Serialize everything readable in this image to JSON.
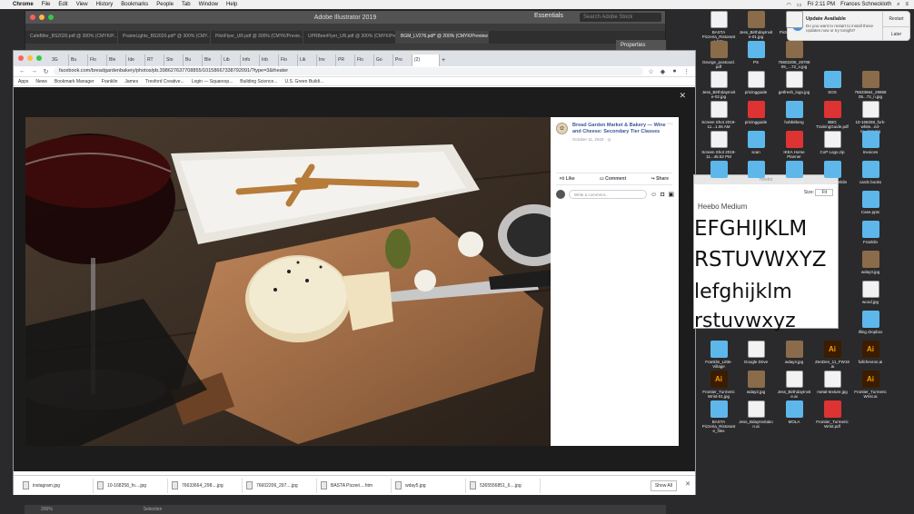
{
  "menubar": {
    "app": "Chrome",
    "items": [
      "File",
      "Edit",
      "View",
      "History",
      "Bookmarks",
      "People",
      "Tab",
      "Window",
      "Help"
    ],
    "clock": "Fri 2:11 PM",
    "user": "Frances Schneckloth"
  },
  "illustrator": {
    "title": "Adobe Illustrator 2019",
    "workspace": "Essentials",
    "search_placeholder": "Search Adobe Stock",
    "tabs": [
      "CafeBifer_BS2020.pdf @ 300% (CMYK/P...",
      "PrairieLights_BS2020.pdf* @ 300% (CMY...",
      "PilotFlyer_UR.pdf @ 300% (CMYK/Previe...",
      "UPRBeerFlyer_UR.pdf @ 300% (CMYK/Prev...",
      "BGM_LV276.pdf* @ 200% (CMYK/Preview)"
    ],
    "active_tab_index": 4,
    "panel": "Properties"
  },
  "chrome": {
    "tabs": [
      "3G",
      "Bu",
      "Flo",
      "Ble",
      "Ide",
      "RT",
      "Sto",
      "Bu",
      "Ble",
      "Lib",
      "Info",
      "Inb",
      "Flo",
      "Lik",
      "Inv",
      "PR",
      "Flo",
      "Go",
      "Pro"
    ],
    "active_tab": "(2)",
    "url": "facebook.com/breadgardenbakery/photos/pb.398627637708855/10158667338792091/?type=3&theater",
    "bookmarks": [
      "Apps",
      "News",
      "Bookmark Manager",
      "Franklin",
      "James",
      "Tresford Creative...",
      "Login — Squaresp...",
      "Building Science...",
      "U.S. Green Buildi..."
    ]
  },
  "post": {
    "page_name": "Bread Garden Market & Bakery",
    "title_rest": " — Wine and Cheese: Secondary Tier Classes",
    "date": "October 11, 2020 · ",
    "like": "Like",
    "comment": "Comment",
    "share": "Share",
    "comment_placeholder": "Write a comment..."
  },
  "downloads": [
    "instagram.jpg",
    "10-168258_fo....jpg",
    "76633664_298....jpg",
    "76602206_297....jpg",
    "BASTA Pizzeri....htm",
    "wday5.jpg",
    "5365556851_6....jpg"
  ],
  "downloads_show_all": "Show All",
  "fontbook": {
    "title": "Heebo",
    "size_label": "Size:",
    "size_value": "Fit",
    "face": "Heebo Medium",
    "lines": [
      "EFGHIJKLM",
      "RSTUVWXYZ",
      "lefghijklm",
      "rstuvwxyz"
    ]
  },
  "notification": {
    "title": "Update Available",
    "body": "Do you want to restart to install these updates now or try tonight?",
    "restart": "Restart",
    "later": "Later"
  },
  "desktop_icons": [
    {
      "label": "BASTA Pizzeria_Ristorante.htm",
      "kind": "file"
    },
    {
      "label": "Jess_BirthdayInvite-01.jpg",
      "kind": "img"
    },
    {
      "label": "Picture ctopping",
      "kind": "file"
    },
    {
      "label": "George_postcard.pdf",
      "kind": "img"
    },
    {
      "label": "PS",
      "kind": "folder"
    },
    {
      "label": "76602206_29708 09_...72_o.jpg",
      "kind": "img"
    },
    {
      "label": "Jess_BirthdayInvite-02.jpg",
      "kind": "file"
    },
    {
      "label": "pricingguide",
      "kind": "file"
    },
    {
      "label": "getfresh_logo.jpg",
      "kind": "file"
    },
    {
      "label": "SOS",
      "kind": "folder"
    },
    {
      "label": "76633664_29858 05...72_n.jpg",
      "kind": "img"
    },
    {
      "label": "Screen Shot 2019-11...1.06 AM",
      "kind": "file"
    },
    {
      "label": "pricingguide",
      "kind": "pdf"
    },
    {
      "label": "hobbitberg",
      "kind": "folder"
    },
    {
      "label": "BBG TrainingGuide.pdf",
      "kind": "pdf"
    },
    {
      "label": "10-168258_fork-white...nd-ro...iron.jpg",
      "kind": "file"
    },
    {
      "label": "Screen Shot 2019-11...45.52 PM",
      "kind": "file"
    },
    {
      "label": "scan",
      "kind": "folder"
    },
    {
      "label": "IKEA Home Planner",
      "kind": "pdf"
    },
    {
      "label": "CoP Logo.zip",
      "kind": "file"
    },
    {
      "label": "Invoices",
      "kind": "folder"
    },
    {
      "label": "Cabin Photos",
      "kind": "folder"
    },
    {
      "label": "James",
      "kind": "folder"
    },
    {
      "label": "• CLIENTS",
      "kind": "folder"
    },
    {
      "label": "FrancesFranklin (1).pdf",
      "kind": "folder"
    },
    {
      "label": "cards books",
      "kind": "folder"
    },
    {
      "label": "Case.pptx",
      "kind": "folder"
    },
    {
      "label": "Franklin",
      "kind": "folder"
    },
    {
      "label": "wday3.jpg",
      "kind": "img"
    },
    {
      "label": "wood.jpg",
      "kind": "file"
    },
    {
      "label": "Illing dropbox",
      "kind": "folder"
    },
    {
      "label": "Franklin_Little-Village",
      "kind": "folder"
    },
    {
      "label": "Google Drive",
      "kind": "file"
    },
    {
      "label": "wday4.jpg",
      "kind": "img"
    },
    {
      "label": "ZenDen_11_FW18.ai",
      "kind": "ai"
    },
    {
      "label": "fullchevron.ai",
      "kind": "ai"
    },
    {
      "label": "Frontier_TurmericWrist-01.jpg",
      "kind": "ai"
    },
    {
      "label": "wday2.jpg",
      "kind": "img"
    },
    {
      "label": "Jess_BirthdayInvite.ai",
      "kind": "file"
    },
    {
      "label": "metal-texture.jpg",
      "kind": "file"
    },
    {
      "label": "Frontier_TurmericWrist.ai",
      "kind": "ai"
    },
    {
      "label": "BASTA Pizzeria_Ristorante_files",
      "kind": "folder"
    },
    {
      "label": "Jess_BdayInvitation.ai",
      "kind": "file"
    },
    {
      "label": "MOLA",
      "kind": "folder"
    },
    {
      "label": "Frontier_TurmericWrist.pdf",
      "kind": "pdf"
    }
  ],
  "bottom_strip": [
    "200%",
    "Selection"
  ],
  "colors": {
    "fb_blue": "#385898",
    "folder_blue": "#5db7ea",
    "lightbox": "#1c1c1c"
  }
}
